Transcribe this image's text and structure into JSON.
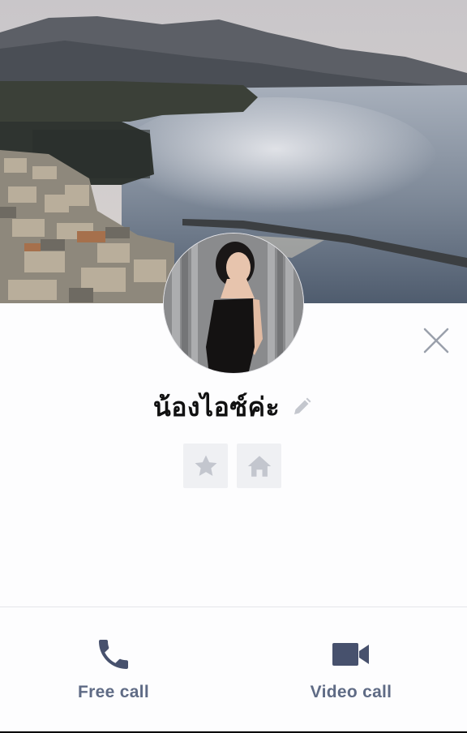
{
  "profile": {
    "name": "น้องไอซ์ค่ะ"
  },
  "icons": {
    "close": "close-icon",
    "edit": "pencil-icon",
    "favorite": "star-icon",
    "home": "home-icon",
    "phone": "phone-icon",
    "video": "video-camera-icon"
  },
  "calls": {
    "free_call_label": "Free call",
    "video_call_label": "Video call"
  },
  "colors": {
    "accent": "#47516d",
    "label": "#5f6b85",
    "action_bg": "#eff0f3",
    "action_icon": "#c3c6ce",
    "close": "#9aa0ab"
  }
}
